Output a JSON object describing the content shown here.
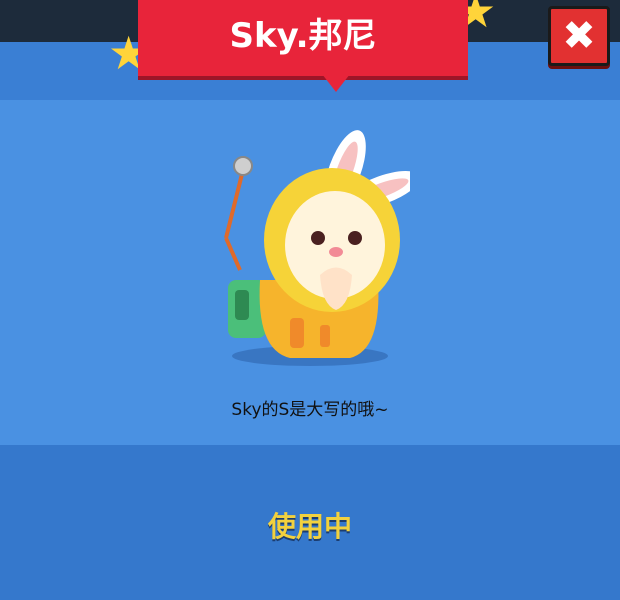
{
  "header": {
    "title": "Sky.邦尼"
  },
  "character": {
    "name": "bunny-sky-skin"
  },
  "description": "Sky的S是大写的哦~",
  "status_label": "使用中",
  "colors": {
    "banner": "#e8243a",
    "panel": "#3a7fd4",
    "status": "#f2d13e",
    "close": "#e23131"
  },
  "icons": {
    "close": "close-icon",
    "star": "star-icon"
  }
}
